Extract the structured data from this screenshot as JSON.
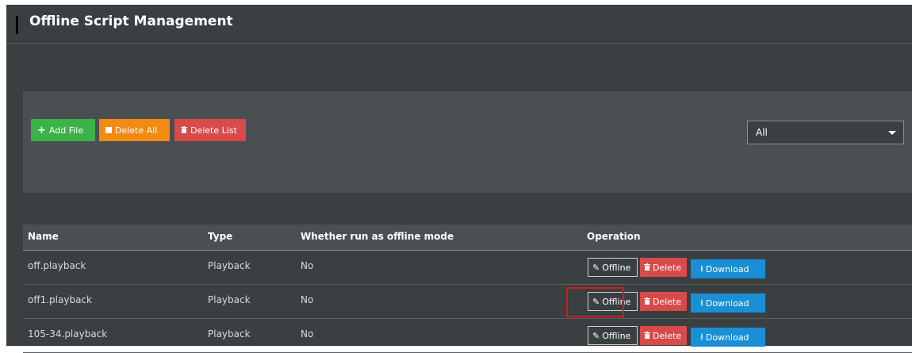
{
  "header": {
    "title": "Offline Script Management"
  },
  "toolbar": {
    "add_label": "Add File",
    "delete_all_label": "Delete All",
    "delete_list_label": "Delete List",
    "filter_value": "All"
  },
  "table": {
    "columns": [
      "Name",
      "Type",
      "Whether run as offline mode",
      "Operation"
    ],
    "rows": [
      {
        "name": "off.playback",
        "type": "Playback",
        "offline_mode": "No"
      },
      {
        "name": "off1.playback",
        "type": "Playback",
        "offline_mode": "No"
      },
      {
        "name": "105-34.playback",
        "type": "Playback",
        "offline_mode": "No"
      }
    ],
    "actions": {
      "offline": "Offline",
      "delete": "Delete",
      "download": "Download"
    }
  },
  "colors": {
    "panel": "#3a3f41",
    "add": "#3bb346",
    "delete_all": "#f28a14",
    "delete": "#d94a4a",
    "download": "#1b8fd6",
    "highlight": "#cc1f1f"
  }
}
